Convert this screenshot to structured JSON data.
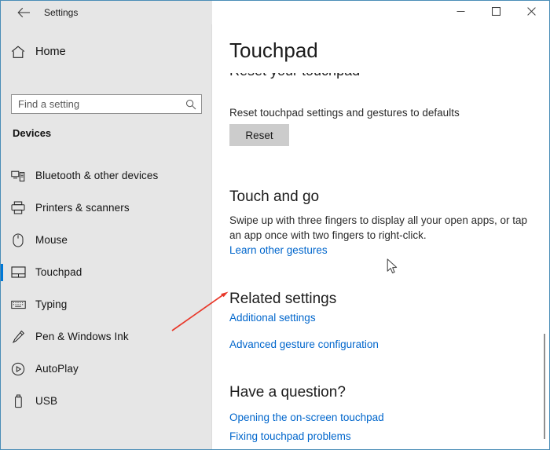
{
  "titlebar": {
    "back_icon": "back-arrow-icon",
    "app_title": "Settings",
    "minimize_label": "─",
    "maximize_label": "□",
    "close_label": "✕"
  },
  "sidebar": {
    "home": {
      "label": "Home",
      "icon": "home-icon"
    },
    "search": {
      "placeholder": "Find a setting",
      "value": "",
      "icon": "search-icon"
    },
    "category_header": "Devices",
    "items": [
      {
        "label": "Bluetooth & other devices",
        "icon": "bluetooth-devices-icon",
        "selected": false
      },
      {
        "label": "Printers & scanners",
        "icon": "printer-icon",
        "selected": false
      },
      {
        "label": "Mouse",
        "icon": "mouse-icon",
        "selected": false
      },
      {
        "label": "Touchpad",
        "icon": "touchpad-icon",
        "selected": true
      },
      {
        "label": "Typing",
        "icon": "keyboard-icon",
        "selected": false
      },
      {
        "label": "Pen & Windows Ink",
        "icon": "pen-icon",
        "selected": false
      },
      {
        "label": "AutoPlay",
        "icon": "autoplay-icon",
        "selected": false
      },
      {
        "label": "USB",
        "icon": "usb-icon",
        "selected": false
      }
    ]
  },
  "content": {
    "page_title": "Touchpad",
    "reset_section": {
      "heading": "Reset your touchpad",
      "description": "Reset touchpad settings and gestures to defaults",
      "button_label": "Reset"
    },
    "touch_and_go": {
      "heading": "Touch and go",
      "description": "Swipe up with three fingers to display all your open apps, or tap an app once with two fingers to right-click.",
      "link": "Learn other gestures"
    },
    "related_settings": {
      "heading": "Related settings",
      "links": [
        "Additional settings",
        "Advanced gesture configuration"
      ]
    },
    "have_a_question": {
      "heading": "Have a question?",
      "links": [
        "Opening the on-screen touchpad",
        "Fixing touchpad problems"
      ]
    }
  },
  "annotation": {
    "arrow_color": "#e8382a",
    "target": "Additional settings"
  },
  "colors": {
    "window_border": "#4a8db7",
    "sidebar_bg": "#e6e6e6",
    "content_bg": "#ffffff",
    "accent": "#0078d7",
    "link": "#0066cc",
    "button_bg": "#cccccc"
  }
}
